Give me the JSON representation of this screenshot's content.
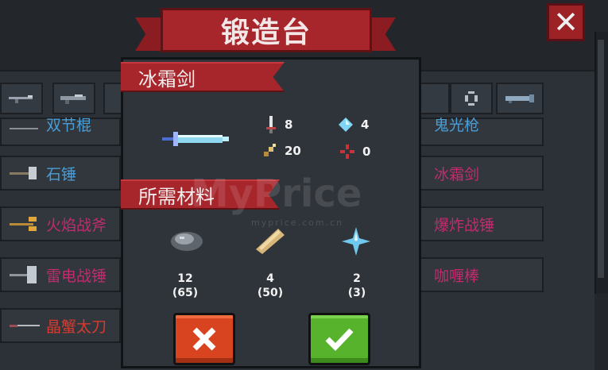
{
  "title": "锻造台",
  "close_label": "✕",
  "watermark": {
    "main": "MyPrice",
    "sub": "myprice.com.cn"
  },
  "left_rows": [
    {
      "label": "双节棍",
      "color": "#4a9ed8",
      "icon": "nunchaku-icon"
    },
    {
      "label": "石锤",
      "color": "#4a9ed8",
      "icon": "stone-hammer-icon"
    },
    {
      "label": "火焰战斧",
      "color": "#c22c6e",
      "icon": "flame-axe-icon"
    },
    {
      "label": "雷电战锤",
      "color": "#c22c6e",
      "icon": "thunder-hammer-icon"
    },
    {
      "label": "晶蟹太刀",
      "color": "#d83a30",
      "icon": "crystal-crab-katana-icon"
    }
  ],
  "right_rows": [
    {
      "label": "鬼光枪",
      "color": "#4a9ed8"
    },
    {
      "label": "冰霜剑",
      "color": "#c22c6e"
    },
    {
      "label": "爆炸战锤",
      "color": "#c22c6e"
    },
    {
      "label": "咖喱棒",
      "color": "#c22c6e"
    }
  ],
  "modal": {
    "weapon_name": "冰霜剑",
    "stats": {
      "damage": "8",
      "energy": "4",
      "crit": "20",
      "accuracy": "0"
    },
    "materials_title": "所需材料",
    "materials": [
      {
        "name": "ore-icon",
        "required": "12",
        "owned": "(65)"
      },
      {
        "name": "wood-plank-icon",
        "required": "4",
        "owned": "(50)"
      },
      {
        "name": "ice-crystal-icon",
        "required": "2",
        "owned": "(3)"
      }
    ],
    "cancel_icon": "close-icon",
    "confirm_icon": "check-icon"
  },
  "colors": {
    "accent_red": "#a6262c",
    "cancel": "#d7441f",
    "confirm": "#56b32b",
    "common": "#4a9ed8",
    "rare": "#c22c6e"
  }
}
